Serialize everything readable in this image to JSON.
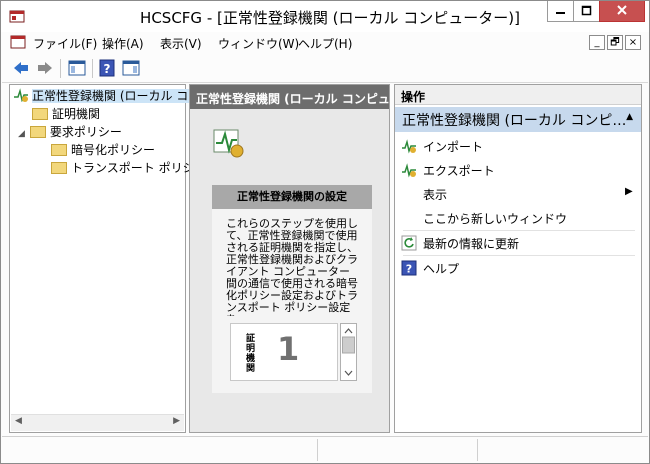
{
  "window": {
    "title": "HCSCFG - [正常性登録機関 (ローカル コンピューター)]"
  },
  "menu": {
    "items": [
      "ファイル(F)",
      "操作(A)",
      "表示(V)",
      "ウィンドウ(W)",
      "ヘルプ(H)"
    ],
    "mdi": {
      "minimize": "_",
      "restore": "🗗",
      "close": "×"
    }
  },
  "tree": {
    "root": "正常性登録機関 (ローカル コンピューター)",
    "items": [
      {
        "label": "証明機関"
      },
      {
        "label": "要求ポリシー"
      },
      {
        "label": "暗号化ポリシー"
      },
      {
        "label": "トランスポート ポリシー"
      }
    ]
  },
  "middle": {
    "header": "正常性登録機関 (ローカル コンピュ…",
    "settings_title": "正常性登録機関の設定",
    "settings_text": "これらのステップを使用して、正常性登録機関で使用される証明機関を指定し、正常性登録機関およびクライアント コンピューター間の通信で使用される暗号化ポリシー設定およびトランスポート ポリシー設定を",
    "step_label": "証明機関",
    "step_number": "1"
  },
  "actions": {
    "header": "操作",
    "selected": "正常性登録機関 (ローカル コンピ…",
    "items": [
      {
        "label": "インポート",
        "icon": "import-icon"
      },
      {
        "label": "エクスポート",
        "icon": "export-icon"
      },
      {
        "label": "表示",
        "icon": "none"
      },
      {
        "label": "ここから新しいウィンドウ",
        "icon": "none"
      },
      {
        "label": "最新の情報に更新",
        "icon": "refresh-icon"
      },
      {
        "label": "ヘルプ",
        "icon": "help-icon"
      }
    ]
  },
  "colors": {
    "accent_selected": "#c7d9ed",
    "close_button": "#c75050",
    "header_dark": "#6d6d6d"
  }
}
